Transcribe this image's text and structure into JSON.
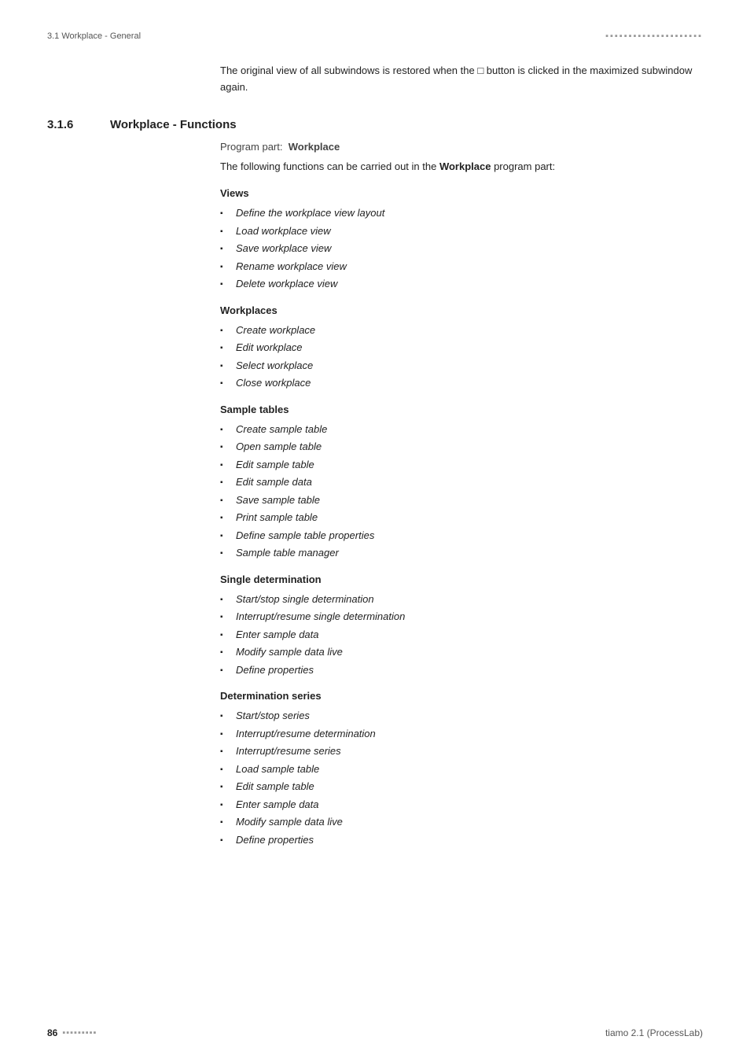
{
  "header": {
    "section_label": "3.1 Workplace - General",
    "dots": "▪▪▪▪▪▪▪▪▪▪▪▪▪▪▪▪▪▪▪▪▪"
  },
  "intro": {
    "text": "The original view of all subwindows is restored when the □ button is clicked in the maximized subwindow again."
  },
  "section": {
    "number": "3.1.6",
    "title": "Workplace - Functions",
    "program_part_label": "Program part:",
    "program_part_value": "Workplace",
    "intro_functions": "The following functions can be carried out in the Workplace program part:"
  },
  "sub_sections": [
    {
      "heading": "Views",
      "items": [
        "Define the workplace view layout",
        "Load workplace view",
        "Save workplace view",
        "Rename workplace view",
        "Delete workplace view"
      ]
    },
    {
      "heading": "Workplaces",
      "items": [
        "Create workplace",
        "Edit workplace",
        "Select workplace",
        "Close workplace"
      ]
    },
    {
      "heading": "Sample tables",
      "items": [
        "Create sample table",
        "Open sample table",
        "Edit sample table",
        "Edit sample data",
        "Save sample table",
        "Print sample table",
        "Define sample table properties",
        "Sample table manager"
      ]
    },
    {
      "heading": "Single determination",
      "items": [
        "Start/stop single determination",
        "Interrupt/resume single determination",
        "Enter sample data",
        "Modify sample data live",
        "Define properties"
      ]
    },
    {
      "heading": "Determination series",
      "items": [
        "Start/stop series",
        "Interrupt/resume determination",
        "Interrupt/resume series",
        "Load sample table",
        "Edit sample table",
        "Enter sample data",
        "Modify sample data live",
        "Define properties"
      ]
    }
  ],
  "footer": {
    "page_number": "86",
    "page_dots": "▪▪▪▪▪▪▪▪▪",
    "product": "tiamo 2.1 (ProcessLab)"
  }
}
